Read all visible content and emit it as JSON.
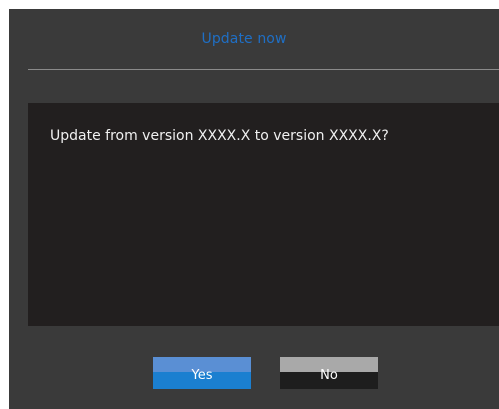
{
  "dialog": {
    "title": "Update now",
    "message": "Update from version XXXX.X to version XXXX.X?",
    "buttons": {
      "yes_label": "Yes",
      "no_label": "No"
    }
  },
  "colors": {
    "title_blue": "#1f6fc5",
    "dialog_bg": "#3a3a3a",
    "panel_bg": "#221f1f",
    "yes_button": "#1b7fd0",
    "no_button": "#1e1e1e"
  }
}
